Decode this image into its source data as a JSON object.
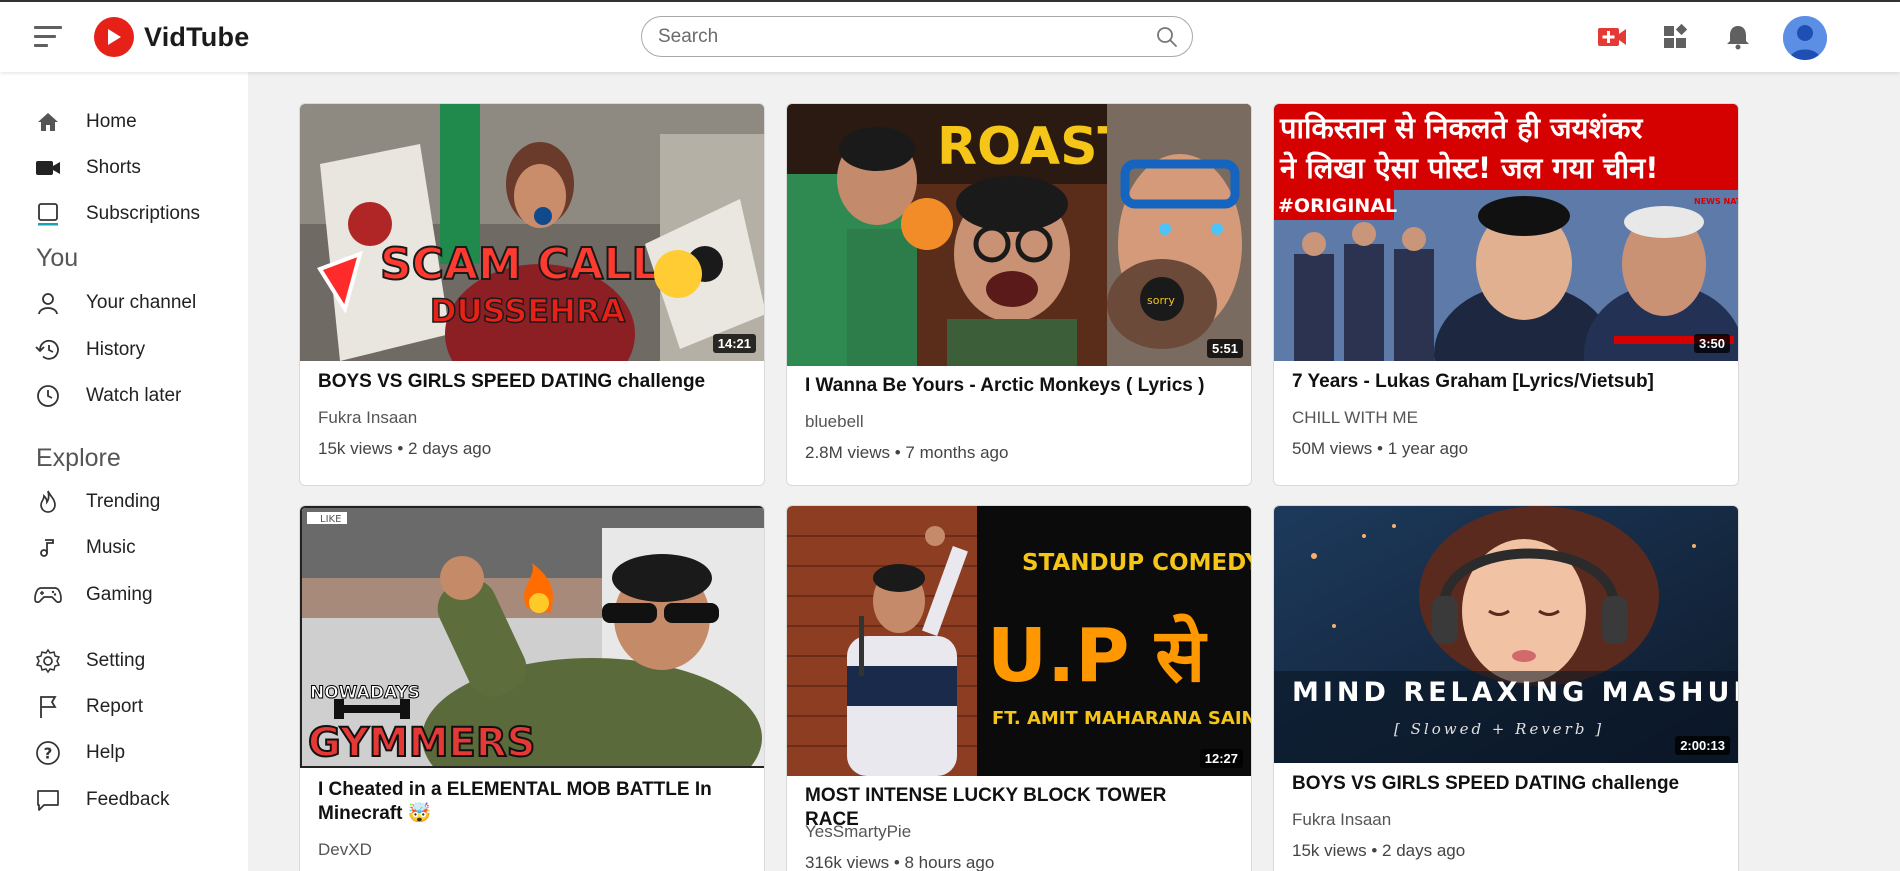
{
  "header": {
    "logo_text": "VidTube",
    "search_placeholder": "Search",
    "icons": [
      "menu-icon",
      "logo-play-icon",
      "search-icon",
      "video-camera-add-icon",
      "apps-grid-icon",
      "notification-bell-icon",
      "user-avatar-icon"
    ]
  },
  "sidebar": {
    "main": [
      {
        "label": "Home",
        "icon": "home-icon"
      },
      {
        "label": "Shorts",
        "icon": "shorts-icon"
      },
      {
        "label": "Subscriptions",
        "icon": "subscriptions-icon"
      }
    ],
    "you_heading": "You",
    "you": [
      {
        "label": "Your channel",
        "icon": "user-icon"
      },
      {
        "label": "History",
        "icon": "history-icon"
      },
      {
        "label": "Watch later",
        "icon": "clock-icon"
      }
    ],
    "explore_heading": "Explore",
    "explore": [
      {
        "label": "Trending",
        "icon": "flame-icon"
      },
      {
        "label": "Music",
        "icon": "music-note-icon"
      },
      {
        "label": "Gaming",
        "icon": "gamepad-icon"
      }
    ],
    "footer": [
      {
        "label": "Setting",
        "icon": "gear-icon"
      },
      {
        "label": "Report",
        "icon": "flag-icon"
      },
      {
        "label": "Help",
        "icon": "help-icon"
      },
      {
        "label": "Feedback",
        "icon": "feedback-icon"
      }
    ]
  },
  "videos": [
    {
      "title": "BOYS VS GIRLS SPEED DATING challenge",
      "channel": "Fukra Insaan",
      "meta": "15k views • 2 days ago",
      "duration": "14:21",
      "thumb_text": [
        "SCAM CALL",
        "DUSSEHRA"
      ],
      "accent": "#c62828"
    },
    {
      "title": "I Wanna Be Yours - Arctic Monkeys ( Lyrics )",
      "channel": "bluebell",
      "meta": "2.8M views • 7 months ago",
      "duration": "5:51",
      "thumb_text": [
        "ROAST",
        "sorry"
      ],
      "accent": "#f5c518"
    },
    {
      "title": "7 Years - Lukas Graham [Lyrics/Vietsub]",
      "channel": "CHILL WITH ME",
      "meta": "50M views • 1 year ago",
      "duration": "3:50",
      "thumb_text": [
        "पाकिस्तान से निकलते ही जयशंकर",
        "ने लिखा ऐसा पोस्ट! जल गया चीन!",
        "#ORIGINAL",
        "NEWS NATION DIGITAL"
      ],
      "accent": "#d50000"
    },
    {
      "title": "I Cheated in a ELEMENTAL MOB BATTLE In Minecraft 🤯",
      "channel": "DevXD",
      "meta": "",
      "duration": "",
      "thumb_text": [
        "NOWADAYS",
        "GYMMERS",
        "LIKE"
      ],
      "accent": "#e53935"
    },
    {
      "title": "MOST INTENSE LUCKY BLOCK TOWER RACE",
      "channel": "YesSmartyPie",
      "meta": "316k views • 8 hours ago",
      "duration": "12:27",
      "thumb_text": [
        "STANDUP COMEDY",
        "U.P से",
        "FT. AMIT MAHARANA SAINI"
      ],
      "accent": "#ff9800"
    },
    {
      "title": "BOYS VS GIRLS SPEED DATING challenge",
      "channel": "Fukra Insaan",
      "meta": "15k views • 2 days ago",
      "duration": "2:00:13",
      "thumb_text": [
        "MIND RELAXING MASHUP",
        "[ Slowed + Reverb ]"
      ],
      "accent": "#26364f"
    }
  ]
}
